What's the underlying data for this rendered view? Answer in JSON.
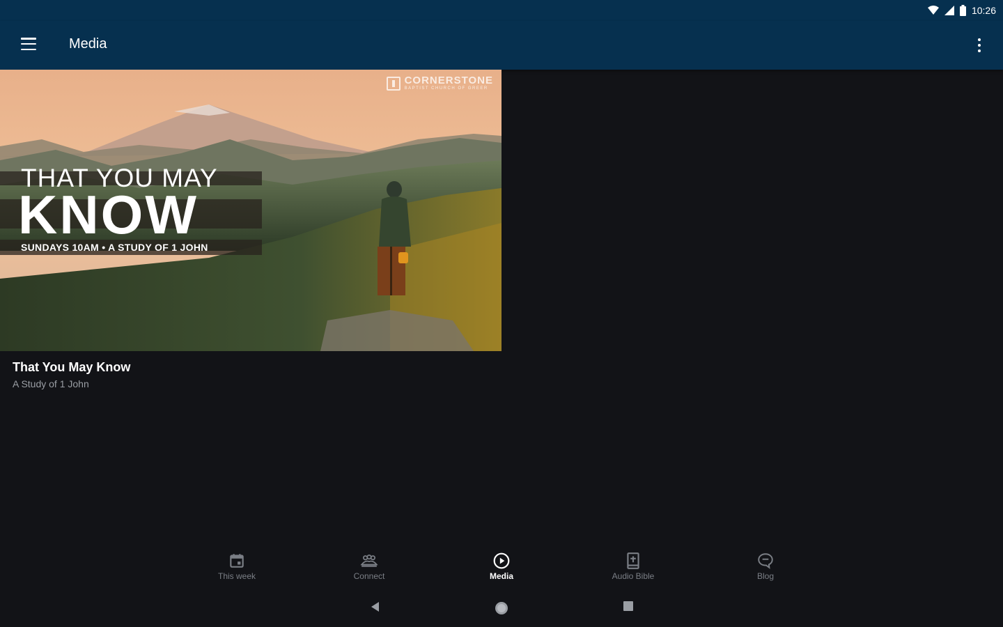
{
  "status_bar": {
    "time": "10:26"
  },
  "app_bar": {
    "title": "Media"
  },
  "hero": {
    "logo_name": "CORNERSTONE",
    "logo_sub": "BAPTIST CHURCH OF GREER",
    "banner_line1": "THAT YOU MAY",
    "banner_line2": "KNOW",
    "banner_line3": "SUNDAYS 10AM  •  A STUDY OF 1 JOHN"
  },
  "media_item": {
    "title": "That You May Know",
    "subtitle": "A Study of 1 John"
  },
  "bottom_nav": {
    "items": [
      {
        "label": "This week",
        "icon": "calendar-icon",
        "active": false
      },
      {
        "label": "Connect",
        "icon": "people-icon",
        "active": false
      },
      {
        "label": "Media",
        "icon": "play-circle-icon",
        "active": true
      },
      {
        "label": "Audio Bible",
        "icon": "bible-icon",
        "active": false
      },
      {
        "label": "Blog",
        "icon": "chat-bubble-icon",
        "active": false
      }
    ]
  },
  "colors": {
    "app_bar": "#06304f",
    "background": "#121317",
    "nav_inactive": "#7b7f86",
    "nav_active": "#ffffff"
  }
}
